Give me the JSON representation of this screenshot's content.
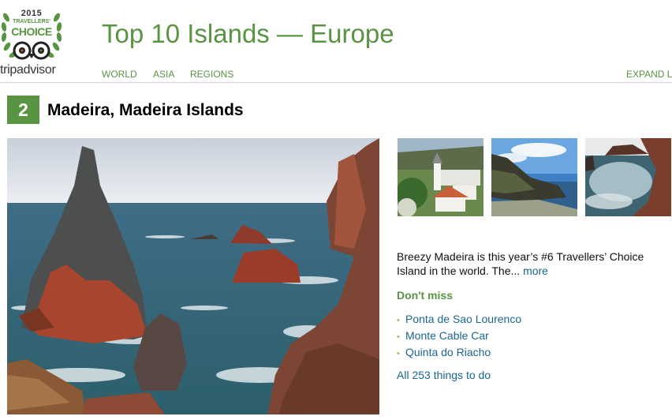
{
  "badge": {
    "year": "2015",
    "travellers": "TRAVELLERS'",
    "choice": "CHOICE",
    "brand": "tripadvisor",
    "icon": "owl-eyes-icon"
  },
  "header": {
    "title": "Top 10 Islands — Europe",
    "nav": [
      "WORLD",
      "ASIA",
      "REGIONS"
    ],
    "expand_label": "EXPAND LIST"
  },
  "entry": {
    "rank": "2",
    "name": "Madeira, Madeira Islands",
    "description": "Breezy Madeira is this year’s #6 Travellers’ Choice Island in the world. The...",
    "more_label": "more",
    "dont_miss_label": "Don't miss",
    "dont_miss": [
      "Ponta de Sao Lourenco",
      "Monte Cable Car",
      "Quinta do Riacho"
    ],
    "all_things_label": "All 253 things to do"
  },
  "colors": {
    "brand_green": "#589442",
    "link_blue": "#1a6691",
    "bullet_green": "#8cbb6b",
    "divider": "#d4d4d4"
  }
}
